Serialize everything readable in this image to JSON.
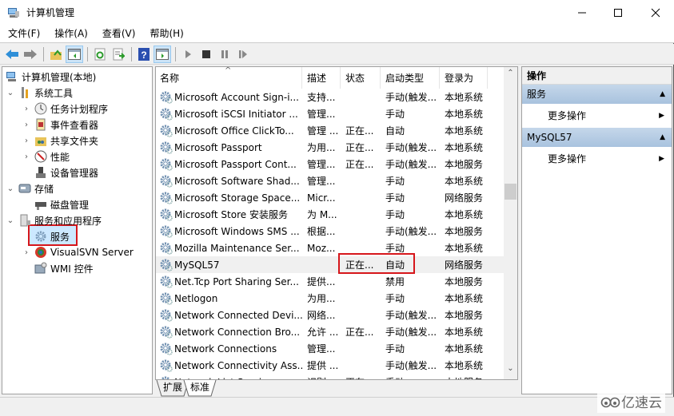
{
  "window": {
    "title": "计算机管理"
  },
  "menu": [
    {
      "label": "文件(F)"
    },
    {
      "label": "操作(A)"
    },
    {
      "label": "查看(V)"
    },
    {
      "label": "帮助(H)"
    }
  ],
  "toolbar": {
    "buttons": [
      "back-icon",
      "forward-icon",
      "up-folder-icon",
      "show-hide-tree-icon",
      "refresh-icon",
      "export-list-icon",
      "help-icon",
      "show-hide-action-pane-icon",
      "start-service-icon",
      "stop-service-icon",
      "pause-service-icon",
      "restart-service-icon"
    ]
  },
  "tree": {
    "root": "计算机管理(本地)",
    "system_tools": "系统工具",
    "task_scheduler": "任务计划程序",
    "event_viewer": "事件查看器",
    "shared_folders": "共享文件夹",
    "performance": "性能",
    "device_manager": "设备管理器",
    "storage": "存储",
    "disk_management": "磁盘管理",
    "services_apps": "服务和应用程序",
    "services": "服务",
    "visualsvn": "VisualSVN Server",
    "wmi": "WMI 控件"
  },
  "list": {
    "columns": [
      "名称",
      "描述",
      "状态",
      "启动类型",
      "登录为"
    ],
    "rows": [
      [
        "Microsoft Account Sign-i...",
        "支持...",
        "",
        "手动(触发...",
        "本地系统"
      ],
      [
        "Microsoft iSCSI Initiator ...",
        "管理...",
        "",
        "手动",
        "本地系统"
      ],
      [
        "Microsoft Office ClickTo...",
        "管理 ...",
        "正在...",
        "自动",
        "本地系统"
      ],
      [
        "Microsoft Passport",
        "为用...",
        "正在...",
        "手动(触发...",
        "本地系统"
      ],
      [
        "Microsoft Passport Cont...",
        "管理...",
        "正在...",
        "手动(触发...",
        "本地服务"
      ],
      [
        "Microsoft Software Shad...",
        "管理...",
        "",
        "手动",
        "本地系统"
      ],
      [
        "Microsoft Storage Space...",
        "Micr...",
        "",
        "手动",
        "网络服务"
      ],
      [
        "Microsoft Store 安装服务",
        "为 M...",
        "",
        "手动",
        "本地系统"
      ],
      [
        "Microsoft Windows SMS ...",
        "根据...",
        "",
        "手动(触发...",
        "本地服务"
      ],
      [
        "Mozilla Maintenance Ser...",
        "Moz...",
        "",
        "手动",
        "本地系统"
      ],
      [
        "MySQL57",
        "",
        "正在...",
        "自动",
        "网络服务"
      ],
      [
        "Net.Tcp Port Sharing Ser...",
        "提供...",
        "",
        "禁用",
        "本地服务"
      ],
      [
        "Netlogon",
        "为用...",
        "",
        "手动",
        "本地系统"
      ],
      [
        "Network Connected Devi...",
        "网络...",
        "",
        "手动(触发...",
        "本地服务"
      ],
      [
        "Network Connection Bro...",
        "允许 ...",
        "正在...",
        "手动(触发...",
        "本地系统"
      ],
      [
        "Network Connections",
        "管理...",
        "",
        "手动",
        "本地系统"
      ],
      [
        "Network Connectivity Ass...",
        "提供 ...",
        "",
        "手动(触发...",
        "本地系统"
      ],
      [
        "Network List Service",
        "识别...",
        "正在...",
        "手动",
        "本地服务"
      ]
    ]
  },
  "tabs": [
    "扩展",
    "标准"
  ],
  "actions": {
    "header": "操作",
    "groups": [
      {
        "title": "服务",
        "item": "更多操作"
      },
      {
        "title": "MySQL57",
        "item": "更多操作"
      }
    ]
  },
  "watermark": "亿速云"
}
